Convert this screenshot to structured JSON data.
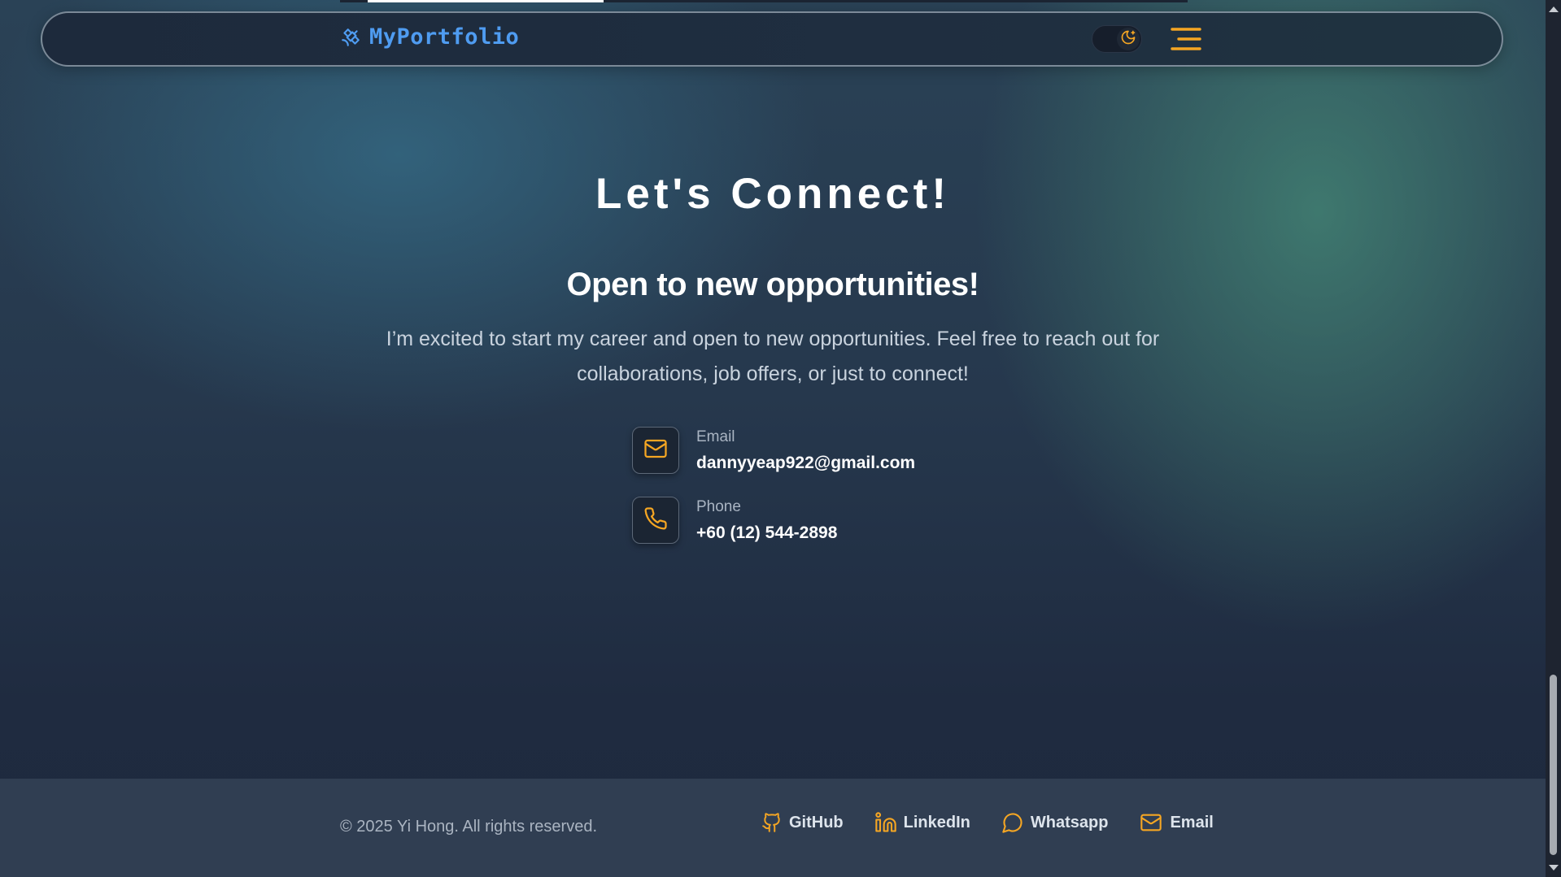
{
  "navbar": {
    "brand": "MyPortfolio",
    "brand_icon": "satellite-icon",
    "theme_icon": "moon-icon",
    "menu_icon": "menu-icon"
  },
  "contact": {
    "title": "Let's Connect!",
    "subtitle": "Open to new opportunities!",
    "intro": "I’m excited to start my career and open to new opportunities. Feel free to reach out for collaborations, job offers, or just to connect!",
    "items": [
      {
        "label": "Email",
        "value": "dannyyeap922@gmail.com",
        "icon": "mail-icon"
      },
      {
        "label": "Phone",
        "value": "+60 (12) 544-2898",
        "icon": "phone-icon"
      }
    ]
  },
  "footer": {
    "copyright": "© 2025 Yi Hong. All rights reserved.",
    "links": [
      {
        "label": "GitHub",
        "icon": "github-icon"
      },
      {
        "label": "LinkedIn",
        "icon": "linkedin-icon"
      },
      {
        "label": "Whatsapp",
        "icon": "whatsapp-icon"
      },
      {
        "label": "Email",
        "icon": "mail-icon"
      }
    ]
  },
  "colors": {
    "accent": "#f5a623",
    "brand": "#4f9cf1",
    "footer_bg": "#303e52"
  }
}
